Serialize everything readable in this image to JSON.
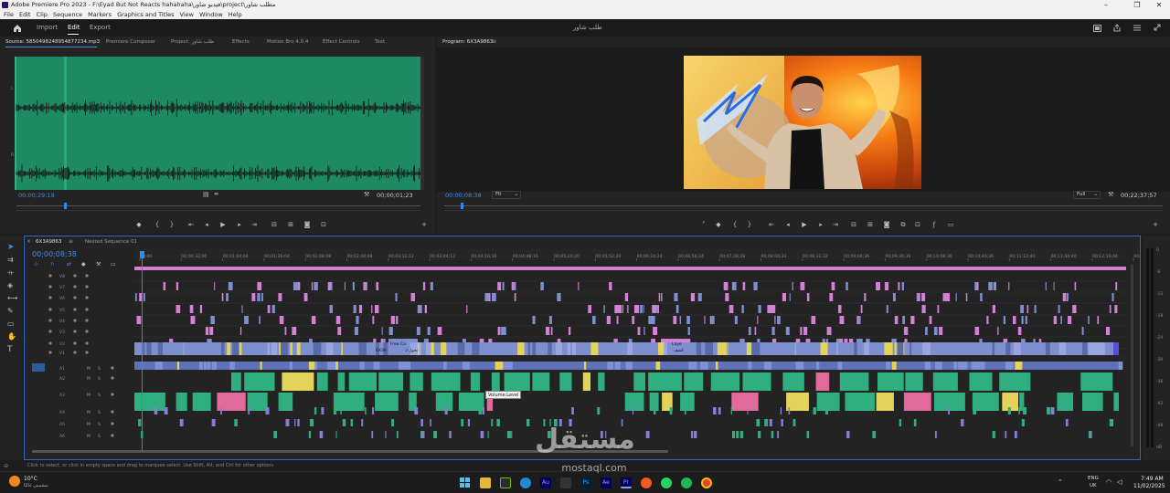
{
  "window": {
    "title": "Adobe Premiere Pro 2023 - F:\\Eyad But Not Reacts hahahaha\\فيديو شاور\\project\\مطلب شاور",
    "controls": [
      "–",
      "❐",
      "✕"
    ]
  },
  "menu": [
    "File",
    "Edit",
    "Clip",
    "Sequence",
    "Markers",
    "Graphics and Titles",
    "View",
    "Window",
    "Help"
  ],
  "header": {
    "workspaces": [
      "Import",
      "Edit",
      "Export"
    ],
    "active_workspace": "Edit",
    "project_title": "طلب شاور"
  },
  "source_panel": {
    "tabs": [
      "Source: 5850498248954877234.mp3",
      "Premiere Composer",
      "Project: طلب شاور",
      "Effects",
      "Motion Bro 4.0.4",
      "Effect Controls",
      "Text"
    ],
    "active_tab": "Source: 5850498248954877234.mp3",
    "timecode": "00;00;29;19",
    "duration": "00;00;01;23",
    "channel_labels": [
      "L",
      "R"
    ],
    "waveform_color": "#1e8a63"
  },
  "program_panel": {
    "tab": "Program: 6X3A9863",
    "timecode": "00;00;08;38",
    "fit": "Fit",
    "quality": "Full",
    "duration": "00;22;37;57"
  },
  "timeline": {
    "tabs": [
      "6X3A9863",
      "Nested Sequence 01"
    ],
    "active_tab": "6X3A9863",
    "timecode": "00;00;08;38",
    "ruler": [
      "00;00",
      "00;00;32;00",
      "00;01;04;04",
      "00;01;36;04",
      "00;02;08;08",
      "00;02;40;08",
      "00;03;12;12",
      "00;03;44;12",
      "00;04;16;16",
      "00;04;48;16",
      "00;05;20;20",
      "00;05;52;20",
      "00;06;24;24",
      "00;06;56;24",
      "00;07;28;28",
      "00;08;00;32",
      "00;08;32;32",
      "00;09;04;36",
      "00;09;36;36",
      "00;10;08;36",
      "00;10;40;36",
      "00;11;12;40",
      "00;11;44;40",
      "00;12;16;44",
      "00;12"
    ],
    "video_tracks": [
      "V8",
      "V7",
      "V6",
      "V5",
      "V4",
      "V3",
      "V2",
      "V1"
    ],
    "audio_tracks": [
      "A1",
      "A2",
      "A3",
      "A4",
      "A5",
      "A6"
    ],
    "clip_labels": [
      "Free Ca",
      "Laye",
      "6X3A",
      "تحول لـ",
      "كشف"
    ],
    "tooltip": "Volume:Level",
    "meter_scale": [
      "0",
      "-6",
      "-12",
      "-18",
      "-24",
      "-30",
      "-36",
      "-42",
      "-48",
      "dB"
    ]
  },
  "status_bar": "Click to select, or click in empty space and drag to marquee select. Use Shift, Alt, and Ctrl for other options.",
  "taskbar": {
    "weather_temp": "10°C",
    "weather_desc": "مشمس غالبًا",
    "lang": "ENG",
    "region": "UK",
    "time": "7:49 AM",
    "date": "11/02/2025",
    "app_labels": [
      "Au",
      "Ps",
      "Ae",
      "Pr"
    ]
  },
  "watermark": {
    "text": "مستقل",
    "url": "mostaql.com"
  },
  "colors": {
    "accent_blue": "#2d8ceb",
    "video_clip": "#7e8fd0",
    "audio_clip": "#2fae7f",
    "pink_clip": "#d57fd6",
    "yellow_clip": "#e3d35a",
    "waveform_bg": "#1e8a63"
  }
}
